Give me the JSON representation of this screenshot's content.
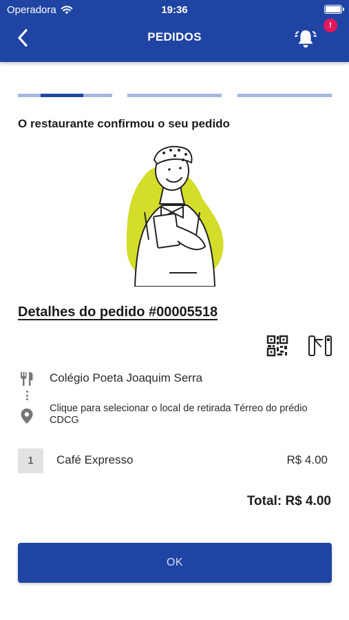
{
  "status_bar": {
    "carrier": "Operadora",
    "time": "19:36",
    "battery_level": 1.0
  },
  "header": {
    "title": "PEDIDOS",
    "back_icon": "chevron-left-icon",
    "notification_icon": "bell-icon",
    "notification_badge": "!"
  },
  "progress_steps": {
    "count": 3,
    "current_step": 1,
    "current_step_fill": 0.45,
    "active_color": "#1f44a3",
    "inactive_color": "#a8b6de"
  },
  "order": {
    "status_message": "O restaurante confirmou o seu pedido",
    "details_title": "Detalhes do pedido #00005518",
    "actions": {
      "qr_icon": "qr-code-icon",
      "gate_icon": "turnstile-icon"
    },
    "restaurant": {
      "icon": "utensils-icon",
      "name": "Colégio Poeta Joaquim Serra"
    },
    "pickup": {
      "icon": "location-pin-icon",
      "text": "Clique para selecionar o local de retirada Térreo do prédio CDCG"
    },
    "items": [
      {
        "quantity": "1",
        "name": "Café Expresso",
        "price": "R$ 4.00"
      }
    ],
    "total": "Total: R$ 4.00"
  },
  "ok_button": {
    "label": "OK"
  },
  "colors": {
    "brand": "#1f44a3",
    "badge": "#e5175b",
    "illustration_blob": "#d4dd2a"
  }
}
